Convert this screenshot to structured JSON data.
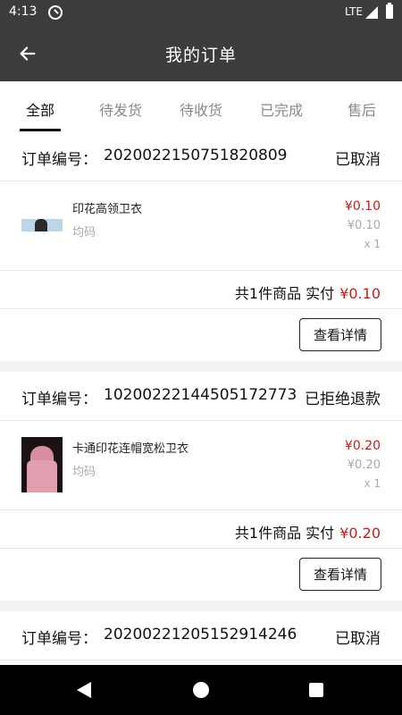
{
  "status_bar": {
    "time": "4:13",
    "network": "LTE"
  },
  "header": {
    "title": "我的订单"
  },
  "tabs": [
    {
      "label": "全部",
      "active": true
    },
    {
      "label": "待发货",
      "active": false
    },
    {
      "label": "待收货",
      "active": false
    },
    {
      "label": "已完成",
      "active": false
    },
    {
      "label": "售后",
      "active": false
    }
  ],
  "orders": [
    {
      "number_label": "订单编号：",
      "number": "2020022150751820809",
      "status": "已取消",
      "item": {
        "name": "印花高领卫衣",
        "spec": "均码",
        "price": "¥0.10",
        "original_price": "¥0.10",
        "quantity": "x 1"
      },
      "summary": {
        "text": "共1件商品  实付",
        "total": "¥0.10"
      },
      "action_label": "查看详情"
    },
    {
      "number_label": "订单编号：",
      "number": "10200222144505172773",
      "status": "已拒绝退款",
      "item": {
        "name": "卡通印花连帽宽松卫衣",
        "spec": "均码",
        "price": "¥0.20",
        "original_price": "¥0.20",
        "quantity": "x 1"
      },
      "summary": {
        "text": "共1件商品  实付",
        "total": "¥0.20"
      },
      "action_label": "查看详情"
    },
    {
      "number_label": "订单编号：",
      "number": "2020022120515291424​6",
      "status": "已取消"
    }
  ],
  "colors": {
    "header_bg": "#3c3c3c",
    "price_red": "#d01818",
    "muted_gray": "#aaaaaa"
  }
}
